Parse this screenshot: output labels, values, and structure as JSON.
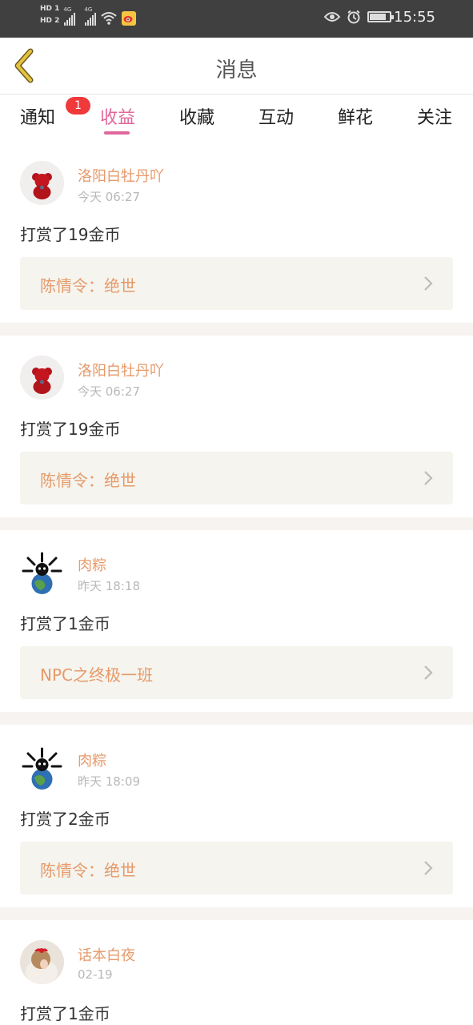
{
  "status_bar": {
    "hd1": "HD 1",
    "hd2": "HD 2",
    "net1": "4G",
    "net2": "4G",
    "time": "15:55"
  },
  "header": {
    "title": "消息"
  },
  "tabs": [
    {
      "label": "通知",
      "badge": "1"
    },
    {
      "label": "收益"
    },
    {
      "label": "收藏"
    },
    {
      "label": "互动"
    },
    {
      "label": "鲜花"
    },
    {
      "label": "关注"
    }
  ],
  "messages": [
    {
      "user": "洛阳白牡丹吖",
      "time": "今天 06:27",
      "action": "打赏了19金币",
      "work": "陈情令：绝世",
      "avatar": "teddy-bear-avatar"
    },
    {
      "user": "洛阳白牡丹吖",
      "time": "今天 06:27",
      "action": "打赏了19金币",
      "work": "陈情令：绝世",
      "avatar": "teddy-bear-avatar"
    },
    {
      "user": "肉粽",
      "time": "昨天 18:18",
      "action": "打赏了1金币",
      "work": "NPC之终极一班",
      "avatar": "globe-avatar"
    },
    {
      "user": "肉粽",
      "time": "昨天 18:09",
      "action": "打赏了2金币",
      "work": "陈情令：绝世",
      "avatar": "globe-avatar"
    },
    {
      "user": "话本白夜",
      "time": "02-19",
      "action": "打赏了1金币",
      "avatar": "girl-avatar"
    }
  ],
  "colors": {
    "accent": "#e0679b",
    "name": "#e69a6a",
    "badge": "#f0393b",
    "card": "#f5f4ee",
    "back_arrow": "#d9b23a"
  }
}
